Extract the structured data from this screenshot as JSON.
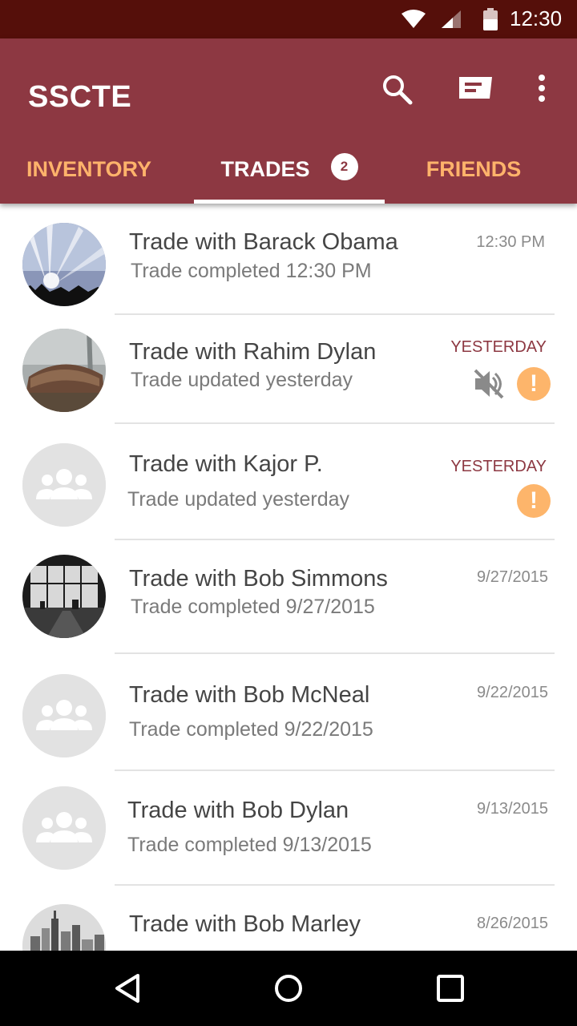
{
  "status_bar": {
    "time": "12:30",
    "icons": [
      "wifi-icon",
      "signal-icon",
      "battery-icon"
    ]
  },
  "app_bar": {
    "title": "SSCTE",
    "actions": [
      "search-icon",
      "message-icon",
      "more-vert-icon"
    ]
  },
  "tabs": [
    {
      "label": "INVENTORY",
      "selected": false
    },
    {
      "label": "TRADES",
      "selected": true,
      "badge": "2"
    },
    {
      "label": "FRIENDS",
      "selected": false
    }
  ],
  "colors": {
    "status_bar": "#550F0A",
    "primary": "#8D3842",
    "tab_inactive": "#FFB36B",
    "alert": "#FDB56B"
  },
  "trades": [
    {
      "title": "Trade with Barack Obama",
      "subtitle": "Trade completed 12:30 PM",
      "time": "12:30 PM",
      "time_accent": false,
      "muted": false,
      "alert": false,
      "avatar": "concert-photo"
    },
    {
      "title": "Trade with Rahim Dylan",
      "subtitle": "Trade updated yesterday",
      "time": "YESTERDAY",
      "time_accent": true,
      "muted": true,
      "alert": true,
      "avatar": "woodpile-photo"
    },
    {
      "title": "Trade with Kajor P.",
      "subtitle": "Trade updated yesterday",
      "time": "YESTERDAY",
      "time_accent": true,
      "muted": false,
      "alert": true,
      "avatar": "group-placeholder"
    },
    {
      "title": "Trade with Bob Simmons",
      "subtitle": "Trade completed 9/27/2015",
      "time": "9/27/2015",
      "time_accent": false,
      "muted": false,
      "alert": false,
      "avatar": "window-photo"
    },
    {
      "title": "Trade with Bob McNeal",
      "subtitle": "Trade completed 9/22/2015",
      "time": "9/22/2015",
      "time_accent": false,
      "muted": false,
      "alert": false,
      "avatar": "group-placeholder"
    },
    {
      "title": "Trade with Bob Dylan",
      "subtitle": "Trade completed 9/13/2015",
      "time": "9/13/2015",
      "time_accent": false,
      "muted": false,
      "alert": false,
      "avatar": "group-placeholder"
    },
    {
      "title": "Trade with Bob Marley",
      "subtitle": "",
      "time": "8/26/2015",
      "time_accent": false,
      "muted": false,
      "alert": false,
      "avatar": "city-photo"
    }
  ],
  "alert_glyph": "!",
  "nav_bar": [
    "back-icon",
    "home-icon",
    "recents-icon"
  ]
}
